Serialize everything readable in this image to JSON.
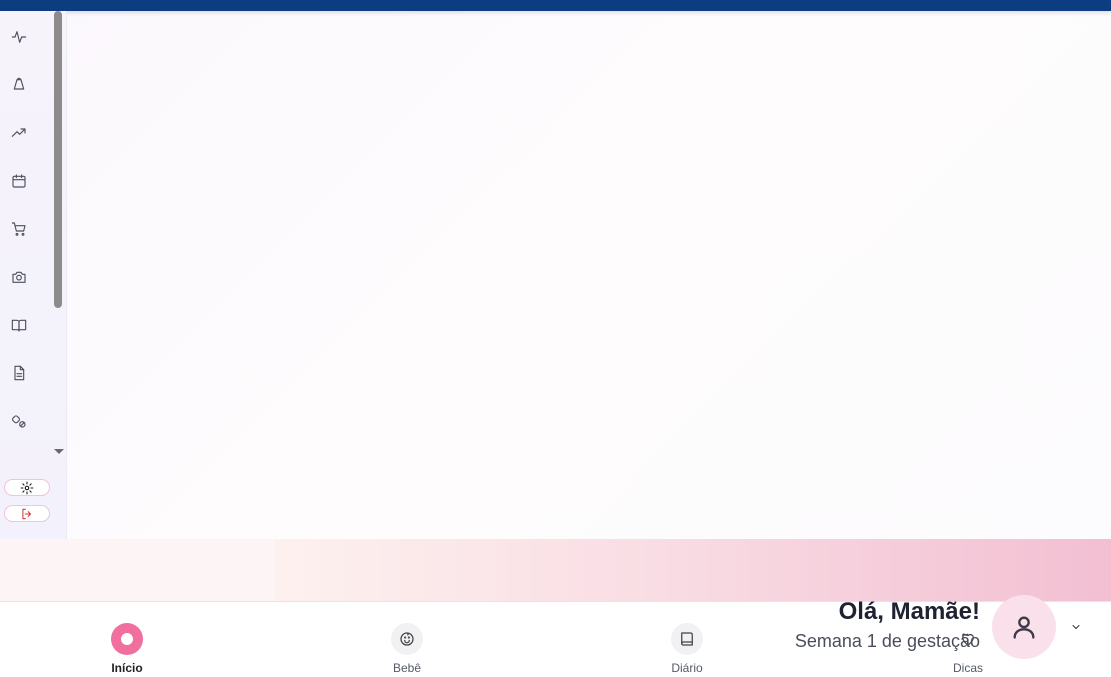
{
  "app": {
    "sidebar": {
      "items": [
        {
          "icon": "activity-icon"
        },
        {
          "icon": "bell-icon"
        },
        {
          "icon": "trending-up-icon"
        },
        {
          "icon": "calendar-icon"
        },
        {
          "icon": "cart-icon"
        },
        {
          "icon": "camera-icon"
        },
        {
          "icon": "book-open-icon"
        },
        {
          "icon": "document-icon"
        },
        {
          "icon": "pill-icon"
        }
      ],
      "settings_icon": "gear-icon",
      "logout_icon": "logout-icon",
      "logout_color": "#d63a3a"
    },
    "greeting": {
      "title": "Olá, Mamãe!",
      "subtitle": "Semana 1 de gestação"
    },
    "bottom_nav": {
      "tabs": [
        {
          "label": "Início",
          "icon": "home-dot-icon",
          "active": true
        },
        {
          "label": "Bebê",
          "icon": "baby-icon",
          "active": false
        },
        {
          "label": "Diário",
          "icon": "book-icon",
          "active": false
        },
        {
          "label": "Dicas",
          "icon": "heart-icon",
          "active": false
        }
      ]
    },
    "colors": {
      "topbar": "#0b3d80",
      "accent": "#f06f9f",
      "banner_end": "#f2bfd2"
    }
  }
}
